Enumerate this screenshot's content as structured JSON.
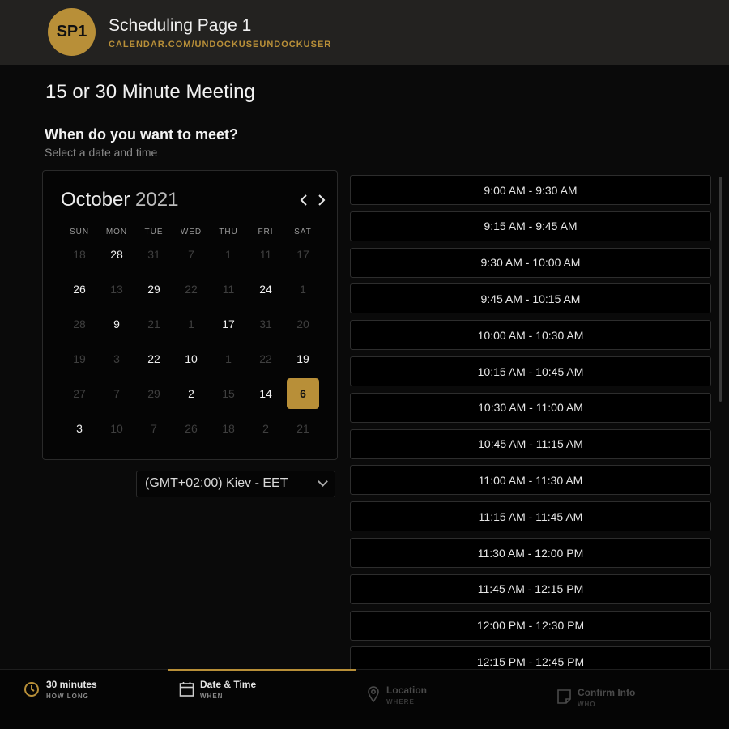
{
  "header": {
    "avatar_initials": "SP1",
    "page_name": "Scheduling Page 1",
    "url": "CALENDAR.COM/UNDOCKUSEUNDOCKUSER",
    "accent": "#b88f38"
  },
  "main": {
    "title": "15 or 30 Minute Meeting",
    "question": "When do you want to meet?",
    "subtitle": "Select a date and time"
  },
  "calendar": {
    "month": "October",
    "year": "2021",
    "weekdays": [
      "SUN",
      "MON",
      "TUE",
      "WED",
      "THU",
      "FRI",
      "SAT"
    ],
    "weeks": [
      [
        {
          "d": "18",
          "a": false
        },
        {
          "d": "28",
          "a": true
        },
        {
          "d": "31",
          "a": false
        },
        {
          "d": "7",
          "a": false
        },
        {
          "d": "1",
          "a": false
        },
        {
          "d": "11",
          "a": false
        },
        {
          "d": "17",
          "a": false
        }
      ],
      [
        {
          "d": "26",
          "a": true
        },
        {
          "d": "13",
          "a": false
        },
        {
          "d": "29",
          "a": true
        },
        {
          "d": "22",
          "a": false
        },
        {
          "d": "11",
          "a": false
        },
        {
          "d": "24",
          "a": true
        },
        {
          "d": "1",
          "a": false
        }
      ],
      [
        {
          "d": "28",
          "a": false
        },
        {
          "d": "9",
          "a": true
        },
        {
          "d": "21",
          "a": false
        },
        {
          "d": "1",
          "a": false
        },
        {
          "d": "17",
          "a": true
        },
        {
          "d": "31",
          "a": false
        },
        {
          "d": "20",
          "a": false
        }
      ],
      [
        {
          "d": "19",
          "a": false
        },
        {
          "d": "3",
          "a": false
        },
        {
          "d": "22",
          "a": true
        },
        {
          "d": "10",
          "a": true
        },
        {
          "d": "1",
          "a": false
        },
        {
          "d": "22",
          "a": false
        },
        {
          "d": "19",
          "a": true
        }
      ],
      [
        {
          "d": "27",
          "a": false
        },
        {
          "d": "7",
          "a": false
        },
        {
          "d": "29",
          "a": false
        },
        {
          "d": "2",
          "a": true
        },
        {
          "d": "15",
          "a": false
        },
        {
          "d": "14",
          "a": true
        },
        {
          "d": "6",
          "a": true,
          "selected": true
        }
      ],
      [
        {
          "d": "3",
          "a": true
        },
        {
          "d": "10",
          "a": false
        },
        {
          "d": "7",
          "a": false
        },
        {
          "d": "26",
          "a": false
        },
        {
          "d": "18",
          "a": false
        },
        {
          "d": "2",
          "a": false
        },
        {
          "d": "21",
          "a": false
        }
      ]
    ]
  },
  "timezone": {
    "value": "(GMT+02:00) Kiev - EET"
  },
  "slots": [
    "9:00 AM - 9:30 AM",
    "9:15 AM - 9:45 AM",
    "9:30 AM - 10:00 AM",
    "9:45 AM - 10:15 AM",
    "10:00 AM - 10:30 AM",
    "10:15 AM - 10:45 AM",
    "10:30 AM - 11:00 AM",
    "10:45 AM - 11:15 AM",
    "11:00 AM - 11:30 AM",
    "11:15 AM - 11:45 AM",
    "11:30 AM - 12:00 PM",
    "11:45 AM - 12:15 PM",
    "12:00 PM - 12:30 PM",
    "12:15 PM - 12:45 PM"
  ],
  "footer": {
    "steps": [
      {
        "label": "30 minutes",
        "sub": "HOW LONG",
        "icon": "clock-icon"
      },
      {
        "label": "Date & Time",
        "sub": "WHEN",
        "icon": "calendar-icon"
      },
      {
        "label": "Location",
        "sub": "WHERE",
        "icon": "location-pin-icon"
      },
      {
        "label": "Confirm Info",
        "sub": "WHO",
        "icon": "note-icon"
      }
    ]
  }
}
